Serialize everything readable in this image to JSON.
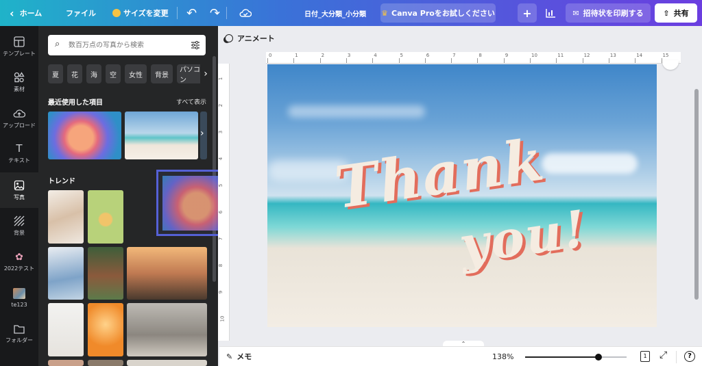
{
  "topbar": {
    "home_label": "ホーム",
    "file_label": "ファイル",
    "resize_label": "サイズを変更",
    "doc_title": "日付_大分類_小分類",
    "pro_label": "Canva Proをお試しください",
    "print_label": "招待状を印刷する",
    "share_label": "共有"
  },
  "rail": {
    "items": [
      {
        "label": "テンプレート",
        "icon": "template-icon"
      },
      {
        "label": "素材",
        "icon": "elements-icon"
      },
      {
        "label": "アップロード",
        "icon": "upload-icon"
      },
      {
        "label": "テキスト",
        "icon": "text-icon"
      },
      {
        "label": "写真",
        "icon": "photo-icon"
      },
      {
        "label": "背景",
        "icon": "background-icon"
      },
      {
        "label": "2022テスト",
        "icon": "flower-icon"
      },
      {
        "label": "te123",
        "icon": "folder-thumb-icon"
      },
      {
        "label": "フォルダー",
        "icon": "folder-icon"
      }
    ]
  },
  "panel": {
    "search_placeholder": "数百万点の写真から検索",
    "chips": [
      "夏",
      "花",
      "海",
      "空",
      "女性",
      "背景",
      "パソコン"
    ],
    "recent_title": "最近使用した項目",
    "see_all": "すべて表示",
    "trend_title": "トレンド"
  },
  "canvas": {
    "animate_label": "アニメート",
    "ruler_h": [
      "0",
      "1",
      "2",
      "3",
      "4",
      "5",
      "6",
      "7",
      "8",
      "9",
      "10",
      "11",
      "12",
      "13",
      "14",
      "15"
    ],
    "ruler_v": [
      "1",
      "2",
      "3",
      "4",
      "5",
      "6",
      "7",
      "8",
      "9",
      "10"
    ],
    "design_text_line1": "Thank",
    "design_text_line2": "you!"
  },
  "bottombar": {
    "notes_label": "メモ",
    "zoom": "138%",
    "zoom_fraction": 0.72,
    "page_count": "1"
  },
  "colors": {
    "accent": "#8b3dff",
    "drag_outline": "#5561d6",
    "text_cream": "#f5ece1",
    "text_shadow": "#e26d5c"
  }
}
